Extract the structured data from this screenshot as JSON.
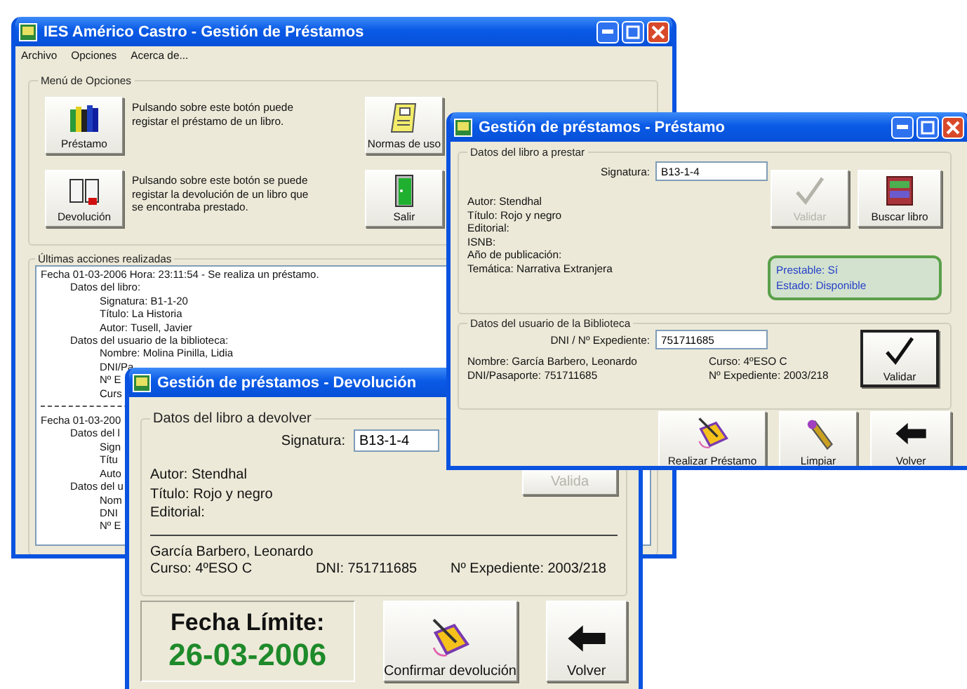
{
  "main_window": {
    "title": "IES Américo Castro - Gestión de Préstamos",
    "menu": [
      "Archivo",
      "Opciones",
      "Acerca de..."
    ],
    "options_group": {
      "title": "Menú de Opciones",
      "options": [
        {
          "label": "Préstamo",
          "description": "Pulsando sobre este botón puede registar el préstamo de un libro."
        },
        {
          "label": "Normas de uso"
        },
        {
          "label": "Devolución",
          "description": "Pulsando sobre este botón se puede registar la devolución de un libro que se encontraba prestado."
        },
        {
          "label": "Salir"
        }
      ]
    },
    "log_group": {
      "title": "Últimas acciones realizadas",
      "entries": [
        {
          "text": "Fecha 01-03-2006 Hora: 23:11:54 - Se realiza un préstamo.",
          "children": [
            {
              "text": "Datos del libro:",
              "children": [
                {
                  "text": "Signatura: B1-1-20"
                },
                {
                  "text": "Título: La Historia"
                },
                {
                  "text": "Autor: Tusell, Javier"
                }
              ]
            },
            {
              "text": "Datos del usuario de la biblioteca:",
              "children": [
                {
                  "text": "Nombre: Molina Pinilla, Lidia"
                },
                {
                  "text": "DNI/Pa"
                },
                {
                  "text": "Nº E"
                },
                {
                  "text": "Curs"
                }
              ]
            }
          ]
        },
        {
          "text": "Fecha 01-03-200",
          "children": [
            {
              "text": "Datos del l",
              "children": [
                {
                  "text": "Sign"
                },
                {
                  "text": "Títu"
                },
                {
                  "text": "Auto"
                }
              ]
            },
            {
              "text": "Datos del u",
              "children": [
                {
                  "text": "Nom"
                },
                {
                  "text": "DNI"
                },
                {
                  "text": "Nº E"
                }
              ]
            }
          ]
        }
      ]
    }
  },
  "loan_window": {
    "title": "Gestión de préstamos - Préstamo",
    "book_group": {
      "title": "Datos del libro a prestar",
      "signature_label": "Signatura:",
      "signature_value": "B13-1-4",
      "details": [
        "Autor: Stendhal",
        "Título: Rojo y negro",
        "Editorial:",
        "ISNB:",
        "Año de publicación:",
        "Temática: Narrativa Extranjera"
      ],
      "validate_button": {
        "label": "Validar",
        "disabled": true
      },
      "search_button": {
        "label": "Buscar libro"
      },
      "status": [
        "Prestable: Sí",
        "Estado: Disponible"
      ]
    },
    "user_group": {
      "title": "Datos del usuario de la Biblioteca",
      "id_label": "DNI / Nº Expediente:",
      "id_value": "751711685",
      "details": [
        "Nombre: García Barbero, Leonardo",
        "Curso: 4ºESO C",
        "DNI/Pasaporte: 751711685",
        "Nº Expediente: 2003/218"
      ],
      "validate_button": {
        "label": "Validar",
        "disabled": false
      }
    },
    "buttons": [
      {
        "label": "Realizar Préstamo"
      },
      {
        "label": "Limpiar"
      },
      {
        "label": "Volver"
      }
    ]
  },
  "return_window": {
    "title": "Gestión de préstamos - Devolución",
    "book_group": {
      "title": "Datos del libro a devolver",
      "signature_label": "Signatura:",
      "signature_value": "B13-1-4",
      "details": [
        "Autor: Stendhal",
        "Título: Rojo y negro",
        "Editorial:"
      ],
      "validate_button": {
        "label": "Valida",
        "disabled": true
      }
    },
    "user_name": "García Barbero, Leonardo",
    "user_details": [
      "Curso: 4ºESO C",
      "DNI: 751711685",
      "Nº Expediente: 2003/218"
    ],
    "due": {
      "label": "Fecha Límite:",
      "date": "26-03-2006"
    },
    "buttons": [
      {
        "label": "Confirmar devolución"
      },
      {
        "label": "Volver"
      }
    ]
  }
}
